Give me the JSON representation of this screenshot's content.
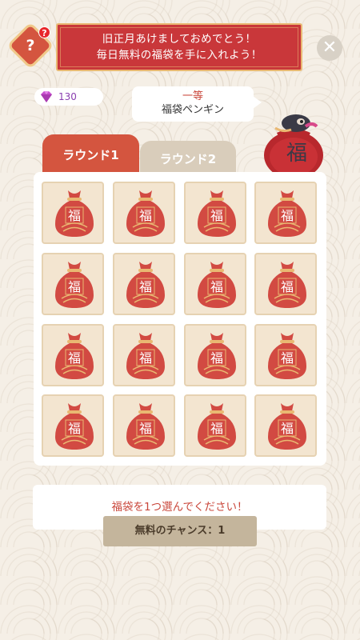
{
  "header": {
    "help_glyph": "?",
    "help_badge": "?",
    "banner_line1": "旧正月あけましておめでとう！",
    "banner_line2": "毎日無料の福袋を手に入れよう！",
    "close_glyph": "✕"
  },
  "currency": {
    "gems": "130",
    "gem_color": "#c84fcf"
  },
  "prize": {
    "rank": "一等",
    "name": "福袋ペンギン"
  },
  "tabs": [
    {
      "label": "ラウンド1",
      "active": true
    },
    {
      "label": "ラウンド2",
      "active": false
    }
  ],
  "board": {
    "bag_glyph": "福",
    "rows": 4,
    "cols": 4
  },
  "footer": {
    "instruction": "福袋を1つ選んでください！",
    "chance_label": "無料のチャンス：1"
  },
  "colors": {
    "accent": "#d4553f",
    "bag": "#d24a42",
    "gold": "#e9b872"
  },
  "icons": {
    "help": "question-icon",
    "close": "close-icon",
    "gem": "gem-icon",
    "bag": "lucky-bag-icon"
  }
}
